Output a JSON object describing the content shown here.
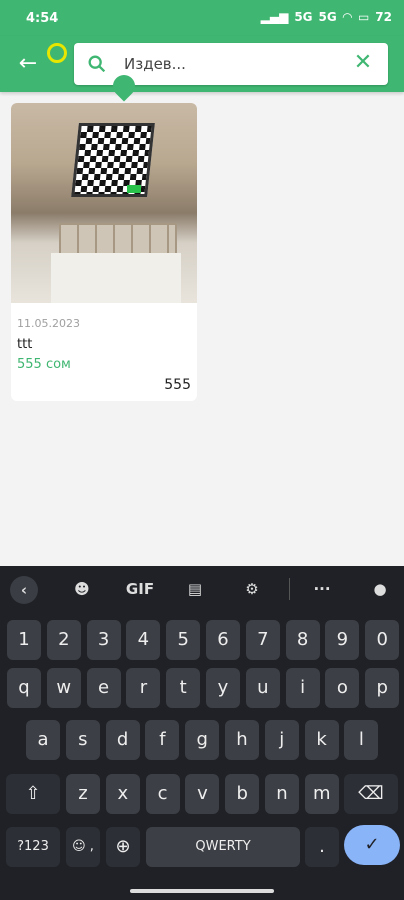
{
  "status": {
    "time": "4:54",
    "battery": "72",
    "net1": "5G",
    "net2": "5G"
  },
  "search": {
    "value": "Издев..."
  },
  "card": {
    "date": "11.05.2023",
    "title": "ttt",
    "price": "555 сом",
    "number": "555"
  },
  "keyboard": {
    "top": {
      "gif": "GIF"
    },
    "row_numbers": [
      "1",
      "2",
      "3",
      "4",
      "5",
      "6",
      "7",
      "8",
      "9",
      "0"
    ],
    "row_q": [
      "q",
      "w",
      "e",
      "r",
      "t",
      "y",
      "u",
      "i",
      "o",
      "p"
    ],
    "row_a": [
      "a",
      "s",
      "d",
      "f",
      "g",
      "h",
      "j",
      "k",
      "l"
    ],
    "row_z": [
      "z",
      "x",
      "c",
      "v",
      "b",
      "n",
      "m"
    ],
    "sym": "?123",
    "comma_top": "☺",
    "comma": ",",
    "space": "QWERTY",
    "period": "."
  }
}
